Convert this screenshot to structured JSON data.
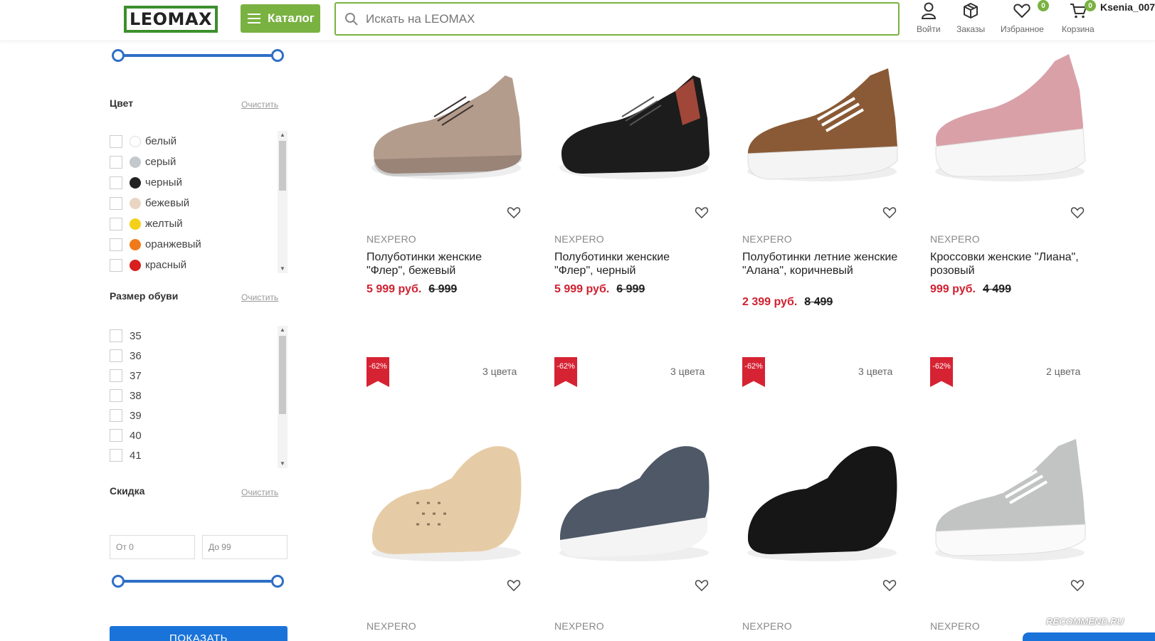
{
  "header": {
    "logo": "LEOMAX",
    "catalog_label": "Каталог",
    "search_placeholder": "Искать на LEOMAX",
    "login_label": "Войти",
    "orders_label": "Заказы",
    "favorites_label": "Избранное",
    "favorites_count": "0",
    "cart_label": "Корзина",
    "cart_count": "0",
    "user_name": "Ksenia_007"
  },
  "sidebar": {
    "color_filter": {
      "title": "Цвет",
      "clear": "Очистить",
      "options": [
        {
          "label": "белый",
          "color": "#ffffff"
        },
        {
          "label": "серый",
          "color": "#c3c8cc"
        },
        {
          "label": "черный",
          "color": "#222222"
        },
        {
          "label": "бежевый",
          "color": "#ead5c3"
        },
        {
          "label": "желтый",
          "color": "#f3d11a"
        },
        {
          "label": "оранжевый",
          "color": "#f07a1a"
        },
        {
          "label": "красный",
          "color": "#d81e1e"
        }
      ]
    },
    "size_filter": {
      "title": "Размер обуви",
      "clear": "Очистить",
      "options": [
        "35",
        "36",
        "37",
        "38",
        "39",
        "40",
        "41"
      ]
    },
    "discount_filter": {
      "title": "Скидка",
      "clear": "Очистить",
      "from_placeholder": "От 0",
      "to_placeholder": "До 99"
    },
    "show_button": "ПОКАЗАТЬ"
  },
  "products_row1": [
    {
      "brand": "NEXPERO",
      "name": "Полуботинки женские \"Флер\", бежевый",
      "price": "5 999 руб.",
      "old_price": "6 999",
      "shoe_color": "#b49c8c"
    },
    {
      "brand": "NEXPERO",
      "name": "Полуботинки женские \"Флер\", черный",
      "price": "5 999 руб.",
      "old_price": "6 999",
      "shoe_color": "#1c1c1c"
    },
    {
      "brand": "NEXPERO",
      "name": "Полуботинки летние женские \"Алана\", коричневый",
      "price": "2 399 руб.",
      "old_price": "8 499",
      "shoe_color": "#8a5a36"
    },
    {
      "brand": "NEXPERO",
      "name": "Кроссовки женские \"Лиана\", розовый",
      "price": "999 руб.",
      "old_price": "4 499",
      "shoe_color": "#d9a0a8"
    }
  ],
  "products_row2": [
    {
      "brand": "NEXPERO",
      "discount": "-62%",
      "colors": "3 цвета",
      "shoe_color": "#e6cca6"
    },
    {
      "brand": "NEXPERO",
      "discount": "-62%",
      "colors": "3 цвета",
      "shoe_color": "#4e5866"
    },
    {
      "brand": "NEXPERO",
      "discount": "-62%",
      "colors": "3 цвета",
      "shoe_color": "#161616"
    },
    {
      "brand": "NEXPERO",
      "discount": "-62%",
      "colors": "2 цвета",
      "shoe_color": "#c2c4c3"
    }
  ],
  "watermark": "RECOMMEND.RU"
}
